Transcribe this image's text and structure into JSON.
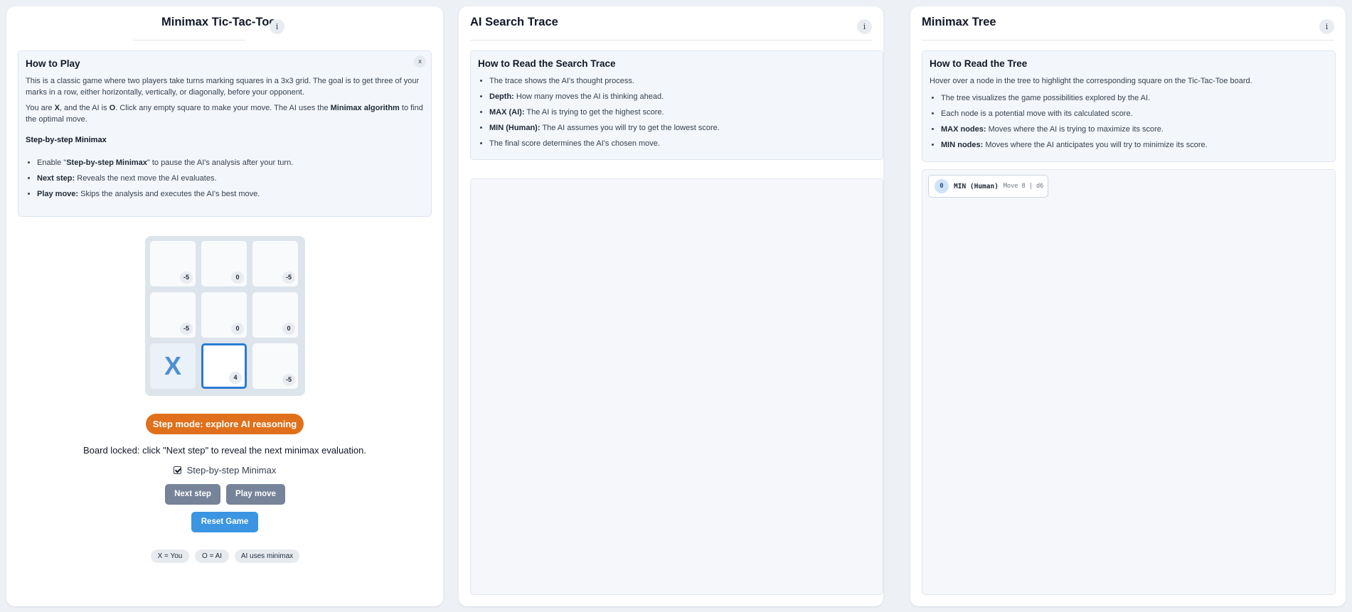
{
  "game_panel": {
    "title": "Minimax Tic-Tac-Toe",
    "info_icon": "i",
    "help": {
      "heading": "How to Play",
      "close_label": "x",
      "p1": "This is a classic game where two players take turns marking squares in a 3x3 grid. The goal is to get three of your marks in a row, either horizontally, vertically, or diagonally, before your opponent.",
      "p2_a": "You are ",
      "p2_x": "X",
      "p2_b": ", and the AI is ",
      "p2_o": "O",
      "p2_c": ". Click any empty square to make your move. The AI uses the ",
      "p2_algo": "Minimax algorithm",
      "p2_d": " to find the optimal move.",
      "subheading": "Step-by-step Minimax",
      "items": [
        {
          "pre": "Enable \"",
          "bold": "Step-by-step Minimax",
          "post": "\" to pause the AI's analysis after your turn."
        },
        {
          "pre": "",
          "bold": "Next step:",
          "post": " Reveals the next move the AI evaluates."
        },
        {
          "pre": "",
          "bold": "Play move:",
          "post": " Skips the analysis and executes the AI's best move."
        }
      ]
    },
    "board": [
      {
        "mark": "",
        "score": "-5"
      },
      {
        "mark": "",
        "score": "0"
      },
      {
        "mark": "",
        "score": "-5"
      },
      {
        "mark": "",
        "score": "-5"
      },
      {
        "mark": "",
        "score": "0"
      },
      {
        "mark": "",
        "score": "0"
      },
      {
        "mark": "X",
        "score": ""
      },
      {
        "mark": "",
        "score": "4"
      },
      {
        "mark": "",
        "score": "-5"
      }
    ],
    "step_mode_label": "Step mode: explore AI reasoning",
    "status_text": "Board locked: click \"Next step\" to reveal the next minimax evaluation.",
    "step_checkbox_label": "Step-by-step Minimax",
    "step_checkbox_checked": true,
    "next_step_label": "Next step",
    "play_move_label": "Play move",
    "reset_label": "Reset Game",
    "legend_chips": [
      "X = You",
      "O = AI",
      "AI uses minimax"
    ]
  },
  "trace_panel": {
    "title": "AI Search Trace",
    "info_icon": "i",
    "help": {
      "heading": "How to Read the Search Trace",
      "items": [
        {
          "bold": "",
          "text": "The trace shows the AI's thought process."
        },
        {
          "bold": "Depth:",
          "text": " How many moves the AI is thinking ahead."
        },
        {
          "bold": "MAX (AI):",
          "text": " The AI is trying to get the highest score."
        },
        {
          "bold": "MIN (Human):",
          "text": " The AI assumes you will try to get the lowest score."
        },
        {
          "bold": "",
          "text": "The final score determines the AI's chosen move."
        }
      ]
    }
  },
  "tree_panel": {
    "title": "Minimax Tree",
    "info_icon": "i",
    "help": {
      "heading": "How to Read the Tree",
      "intro": "Hover over a node in the tree to highlight the corresponding square on the Tic-Tac-Toe board.",
      "items": [
        {
          "bold": "",
          "text": "The tree visualizes the game possibilities explored by the AI."
        },
        {
          "bold": "",
          "text": "Each node is a potential move with its calculated score."
        },
        {
          "bold": "MAX nodes:",
          "text": " Moves where the AI is trying to maximize its score."
        },
        {
          "bold": "MIN nodes:",
          "text": " Moves where the AI anticipates you will try to minimize its score."
        }
      ]
    },
    "root_node": {
      "score": "0",
      "label": "MIN (Human)",
      "meta": "Move 8 | d6"
    }
  },
  "colors": {
    "background": "#edf0f5",
    "accent_orange": "#e0701b",
    "accent_blue": "#3b95e2",
    "button_gray": "#768398",
    "x_mark": "#4c8fd1",
    "selected_cell_border": "#2b7bd0"
  }
}
